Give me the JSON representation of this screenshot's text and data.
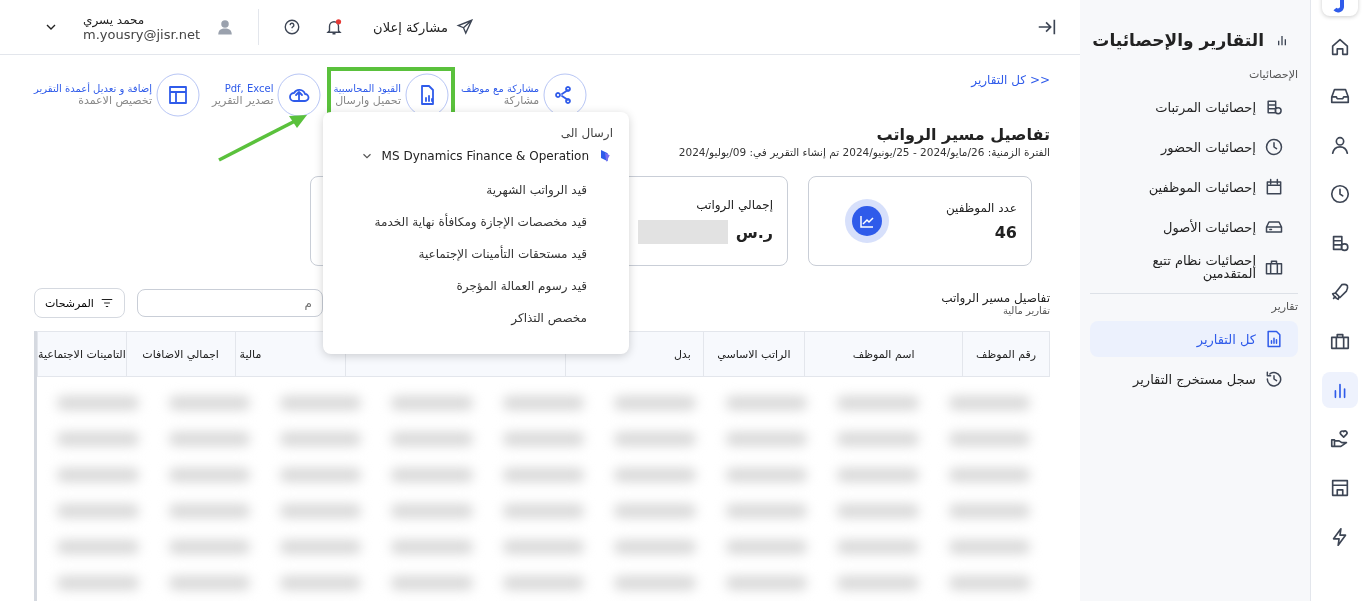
{
  "rail": [
    {
      "kind": "logo",
      "selected": false
    },
    {
      "kind": "home",
      "selected": false
    },
    {
      "kind": "inbox",
      "selected": false
    },
    {
      "kind": "user",
      "selected": false
    },
    {
      "kind": "clock",
      "selected": false
    },
    {
      "kind": "coins",
      "selected": false
    },
    {
      "kind": "rocket",
      "selected": false
    },
    {
      "kind": "briefcase",
      "selected": false
    },
    {
      "kind": "chart",
      "selected": true
    },
    {
      "kind": "hand",
      "selected": false
    },
    {
      "kind": "store",
      "selected": false
    },
    {
      "kind": "bolt",
      "selected": false
    }
  ],
  "sidebar": {
    "title": "التقارير والإحصائيات",
    "sections": [
      {
        "label": "الإحصائيات",
        "items": [
          {
            "label": "إحصائيات المرتبات",
            "kind": "coins",
            "selected": false
          },
          {
            "label": "إحصائيات الحضور",
            "kind": "clock",
            "selected": false
          },
          {
            "label": "إحصائيات الموظفين",
            "kind": "calendar",
            "selected": false
          },
          {
            "label": "إحصائيات الأصول",
            "kind": "drive",
            "selected": false
          },
          {
            "label": "إحصائيات نظام تتبع المتقدمين",
            "kind": "briefcase",
            "selected": false
          }
        ]
      },
      {
        "label": "تقارير",
        "items": [
          {
            "label": "كل التقارير",
            "kind": "report",
            "selected": true
          },
          {
            "label": "سجل مستخرج التقارير",
            "kind": "history",
            "selected": false
          }
        ]
      }
    ]
  },
  "header": {
    "announce": "مشاركة إعلان",
    "notification_dot": true,
    "user_name": "محمد يسري",
    "user_email": "m.yousry@jisr.net"
  },
  "back_link": "<< كل التقارير",
  "actions": [
    {
      "kind": "share",
      "top": "مشاركة مع موظف",
      "bottom": "مشاركة",
      "highlighted": false
    },
    {
      "kind": "accounting",
      "top": "القيود المحاسبية",
      "bottom": "تحميل وارسال",
      "highlighted": true
    },
    {
      "kind": "export",
      "top": "Pdf, Excel",
      "bottom": "تصدير التقرير",
      "highlighted": false
    },
    {
      "kind": "columns",
      "top": "إضافة و تعديل أعمدة التقرير",
      "bottom": "تخصيص الاعمدة",
      "highlighted": false
    }
  ],
  "title": "تفاصيل مسير الرواتب",
  "period": "الفترة الزمنية: 26/مايو/2024 - 25/يونيو/2024 تم إنشاء التقرير في: 09/يوليو/2024",
  "cards": [
    {
      "label": "عدد الموظفين",
      "value": "46"
    },
    {
      "label": "إجمالي الرواتب",
      "value": "ر.س"
    }
  ],
  "table_title": "تفاصيل مسير الرواتب",
  "table_subtitle": "تقارير مالية",
  "search": {
    "placeholder": "م"
  },
  "filter_button": "المرشحات",
  "columns": [
    "رقم الموظف",
    "اسم الموظف",
    "الراتب الاساسي",
    "بدل",
    "",
    "مالية",
    "اجمالي الاضافات",
    "التامينات الاجتماعية"
  ],
  "dropdown": {
    "heading": "ارسال الى",
    "group": "MS Dynamics Finance & Operation",
    "items": [
      "قيد الرواتب الشهرية",
      "قيد مخصصات الإجازة ومكافأة نهاية الخدمة",
      "قيد مستحقات التأمينات الإجتماعية",
      "قيد رسوم العمالة المؤجرة",
      "مخصص التذاكر"
    ]
  }
}
